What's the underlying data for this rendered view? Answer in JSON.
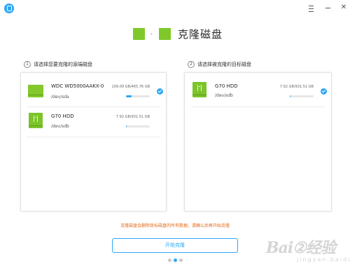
{
  "window": {
    "logo_icon": "deepin-clone-logo-icon",
    "menu_icon": "hamburger-menu-icon",
    "minimize_icon": "minimize-icon",
    "close_symbol": "✕"
  },
  "header": {
    "title": "克隆磁盘",
    "arrow_glyph": "▸"
  },
  "source": {
    "step_number": "1",
    "step_label": "请选择您要克隆的源端磁盘",
    "disks": [
      {
        "name": "WDC WD5000AAKX-0",
        "path": "/dev/sda",
        "size": "109.09 GB/465.76 GB",
        "usage_fraction": 0.23,
        "selected": true,
        "icon": "hard-disk-icon"
      },
      {
        "name": "G70 HDD",
        "path": "/dev/sdb",
        "size": "7.92 GB/931.51 GB",
        "usage_fraction": 0.01,
        "selected": false,
        "icon": "usb-disk-icon"
      }
    ]
  },
  "target": {
    "step_number": "2",
    "step_label": "请选择被克隆的目标磁盘",
    "disks": [
      {
        "name": "G70 HDD",
        "path": "/dev/sdb",
        "size": "7.92 GB/931.51 GB",
        "usage_fraction": 0.01,
        "selected": true,
        "icon": "usb-disk-icon"
      }
    ]
  },
  "warning": "克隆磁盘会删除目标磁盘的所有数据，请确认后再开始克隆",
  "start_button": "开始克隆",
  "pagination": {
    "total": 3,
    "current": 2
  },
  "watermark": {
    "main": "Bai②经验",
    "sub": "jingyan.baidu.com"
  },
  "colors": {
    "accent": "#2ca7f8",
    "disk_green": "#7cc42a",
    "warning": "#e36a1a"
  }
}
